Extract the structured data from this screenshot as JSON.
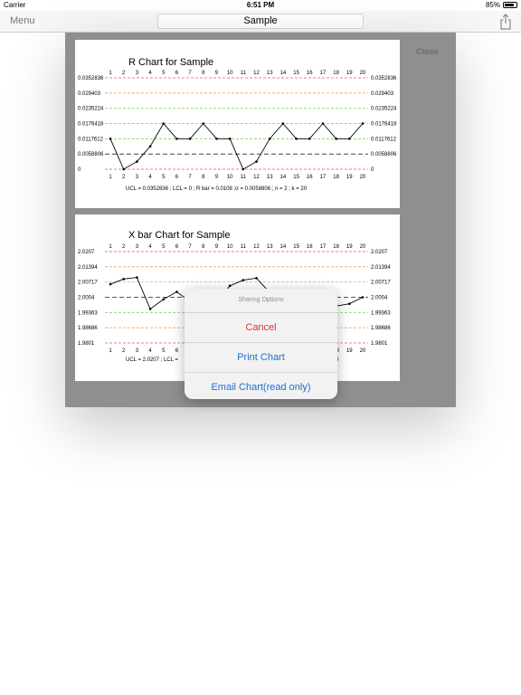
{
  "status_bar": {
    "carrier": "Carrier",
    "time": "6:51 PM",
    "battery": "85%",
    "battery_level": 0.85
  },
  "nav": {
    "menu_label": "Menu",
    "title": "Sample"
  },
  "modal": {
    "close_label": "Close"
  },
  "sharing": {
    "header": "Sharing Options",
    "cancel": "Cancel",
    "print": "Print Chart",
    "email": "Email Chart(read only)"
  },
  "chart_data": [
    {
      "type": "line",
      "title": "R Chart for  Sample",
      "x": [
        1,
        2,
        3,
        4,
        5,
        6,
        7,
        8,
        9,
        10,
        11,
        12,
        13,
        14,
        15,
        16,
        17,
        18,
        19,
        20
      ],
      "values": [
        0.0117612,
        0,
        0.0029403,
        0.0088209,
        0.0176418,
        0.0117612,
        0.0117612,
        0.0176418,
        0.0117612,
        0.0117612,
        0,
        0.0029403,
        0.0117612,
        0.0176418,
        0.0117612,
        0.0117612,
        0.0176418,
        0.0117612,
        0.0117612,
        0.0176418
      ],
      "ylim": [
        0,
        0.0352836
      ],
      "control_lines": [
        {
          "value": 0.0352836,
          "label": "0.0352836",
          "color": "#e55a5a",
          "dash": "3,2"
        },
        {
          "value": 0.029403,
          "label": "0.029403",
          "color": "#f0a060",
          "dash": "3,2"
        },
        {
          "value": 0.0235224,
          "label": "0.0235224",
          "color": "#8fd86a",
          "dash": "3,2"
        },
        {
          "value": 0.0176418,
          "label": "0.0176418",
          "color": "#7ed35a",
          "dash": "3,2"
        },
        {
          "value": 0.0117612,
          "label": "0.0117612",
          "color": "#7ed35a",
          "dash": "3,2"
        },
        {
          "value": 0.0058806,
          "label": "0.0058806",
          "color": "#222222",
          "dash": "5,3"
        },
        {
          "value": 0,
          "label": "0",
          "color": "#e55a5a",
          "dash": "3,2"
        }
      ],
      "footer": "UCL = 0.0352836 ; LCL = 0 ; R bar = 0.0108 ;σ = 0.0058806 ; n = 2 ; k = 20"
    },
    {
      "type": "line",
      "title": "X bar Chart for  Sample",
      "x": [
        1,
        2,
        3,
        4,
        5,
        6,
        7,
        8,
        9,
        10,
        11,
        12,
        13,
        14,
        15,
        16,
        17,
        18,
        19,
        20
      ],
      "values": [
        2.0062,
        2.0085,
        2.0092,
        1.9952,
        1.9995,
        2.0028,
        1.9985,
        1.9985,
        1.9985,
        2.0055,
        2.008,
        2.0089,
        2.0025,
        1.9975,
        2.0035,
        1.9975,
        1.9975,
        1.9965,
        1.9975,
        2.0004
      ],
      "ylim": [
        1.9801,
        2.0207
      ],
      "control_lines": [
        {
          "value": 2.0207,
          "label": "2.0207",
          "color": "#e55a5a",
          "dash": "3,2"
        },
        {
          "value": 2.01394,
          "label": "2.01394",
          "color": "#f0a060",
          "dash": "3,2"
        },
        {
          "value": 2.00717,
          "label": "2.00717",
          "color": "#8fd86a",
          "dash": "3,2"
        },
        {
          "value": 2.0004,
          "label": "2.0004",
          "color": "#222222",
          "dash": "5,3"
        },
        {
          "value": 1.99363,
          "label": "1.99363",
          "color": "#7ed35a",
          "dash": "3,2"
        },
        {
          "value": 1.98686,
          "label": "1.98686",
          "color": "#f0a060",
          "dash": "3,2"
        },
        {
          "value": 1.9801,
          "label": "1.9801",
          "color": "#e55a5a",
          "dash": "3,2"
        }
      ],
      "footer_left": "UCL = 2.0207 ; LCL =",
      "footer_right": "0"
    }
  ]
}
